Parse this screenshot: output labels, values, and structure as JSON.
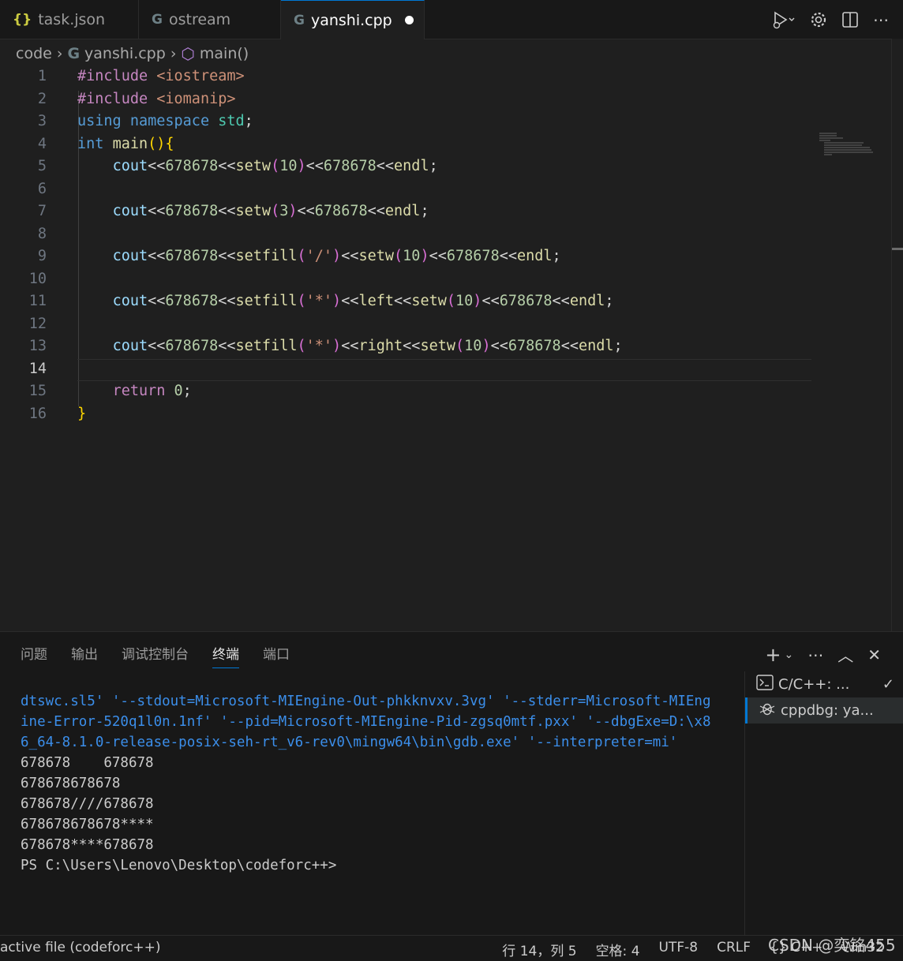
{
  "tabs": [
    {
      "icon": "{}",
      "label": "task.json",
      "active": false
    },
    {
      "icon": "C",
      "label": "ostream",
      "active": false
    },
    {
      "icon": "C",
      "label": "yanshi.cpp",
      "active": true,
      "dirty": true
    }
  ],
  "breadcrumb": {
    "folder": "code",
    "file": "yanshi.cpp",
    "symbol": "main()"
  },
  "editor": {
    "current_line": 14,
    "line_numbers": [
      "1",
      "2",
      "3",
      "4",
      "5",
      "6",
      "7",
      "8",
      "9",
      "10",
      "11",
      "12",
      "13",
      "14",
      "15",
      "16"
    ]
  },
  "panel": {
    "tabs": [
      "问题",
      "输出",
      "调试控制台",
      "终端",
      "端口"
    ],
    "active_tab": "终端",
    "terminal_lines": [
      "dtswc.sl5' '--stdout=Microsoft-MIEngine-Out-phkknvxv.3vg' '--stderr=Microsoft-MIEng",
      "ine-Error-520q1l0n.1nf' '--pid=Microsoft-MIEngine-Pid-zgsq0mtf.pxx' '--dbgExe=D:\\x8",
      "6_64-8.1.0-release-posix-seh-rt_v6-rev0\\mingw64\\bin\\gdb.exe' '--interpreter=mi'",
      "678678    678678",
      "678678678678",
      "678678////678678",
      "678678678678****",
      "678678****678678",
      "PS C:\\Users\\Lenovo\\Desktop\\codeforc++>"
    ],
    "terminals": [
      {
        "label": "C/C++: ...",
        "selected": false
      },
      {
        "label": "cppdbg: ya...",
        "selected": true
      }
    ]
  },
  "statusbar": {
    "left": "active file (codeforc++)",
    "position": "行 14，列 5",
    "indent": "空格: 4",
    "encoding": "UTF-8",
    "eol": "CRLF",
    "lang": "{} C++",
    "platform": "Win32"
  },
  "watermark": "CSDN @奕铭455"
}
